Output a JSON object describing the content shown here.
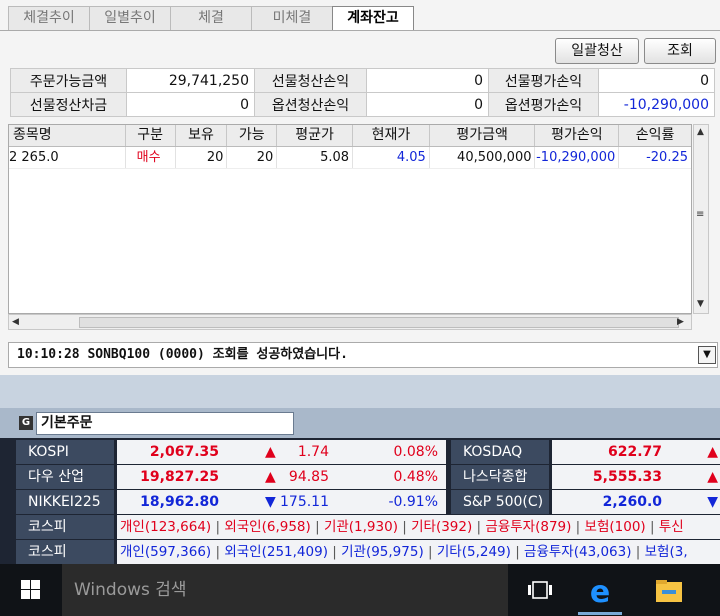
{
  "tabs": [
    {
      "label": "체결추이",
      "active": false
    },
    {
      "label": "일별추이",
      "active": false
    },
    {
      "label": "체결",
      "active": false
    },
    {
      "label": "미체결",
      "active": false
    },
    {
      "label": "계좌잔고",
      "active": true
    }
  ],
  "toolbar": {
    "liquidate_all": "일괄청산",
    "query": "조회"
  },
  "summary": {
    "row1": [
      {
        "label": "주문가능금액",
        "value": "29,741,250"
      },
      {
        "label": "선물청산손익",
        "value": "0"
      },
      {
        "label": "선물평가손익",
        "value": "0"
      }
    ],
    "row2": [
      {
        "label": "선물정산차금",
        "value": "0"
      },
      {
        "label": "옵션청산손익",
        "value": "0"
      },
      {
        "label": "옵션평가손익",
        "value": "-10,290,000"
      }
    ]
  },
  "grid": {
    "headers": [
      "종목명",
      "구분",
      "보유",
      "가능",
      "평균가",
      "현재가",
      "평가금액",
      "평가손익",
      "손익률"
    ],
    "rows": [
      {
        "name": "2 265.0",
        "side": "매수",
        "held": "20",
        "avail": "20",
        "avg": "5.08",
        "cur": "4.05",
        "eval_amt": "40,500,000",
        "eval_pl": "-10,290,000",
        "pl_rate": "-20.25"
      }
    ]
  },
  "status": {
    "message": "10:10:28 SONBQ100 (0000) 조회를 성공하였습니다."
  },
  "order_panel": {
    "icon_letter": "G",
    "title": "기본주문"
  },
  "ticker": {
    "markets": [
      {
        "left_name": "KOSPI",
        "left_value": "2,067.35",
        "left_dir": "up",
        "left_change": "1.74",
        "left_pct": "0.08%",
        "right_name": "KOSDAQ",
        "right_value": "622.77",
        "right_dir": "up"
      },
      {
        "left_name": "다우 산업",
        "left_value": "19,827.25",
        "left_dir": "up",
        "left_change": "94.85",
        "left_pct": "0.48%",
        "right_name": "나스닥종합",
        "right_value": "5,555.33",
        "right_dir": "up"
      },
      {
        "left_name": "NIKKEI225",
        "left_value": "18,962.80",
        "left_dir": "down",
        "left_change": "175.11",
        "left_pct": "-0.91%",
        "right_name": "S&P 500(C)",
        "right_value": "2,260.0",
        "right_dir": "down"
      }
    ],
    "investor_rows": [
      {
        "name": "코스피",
        "color": "#e0001c",
        "items": [
          "개인(123,664)",
          "외국인(6,958)",
          "기관(1,930)",
          "기타(392)",
          "금융투자(879)",
          "보험(100)",
          "투신"
        ]
      },
      {
        "name": "코스피",
        "color": "#1226d8",
        "items": [
          "개인(597,366)",
          "외국인(251,409)",
          "기관(95,975)",
          "기타(5,249)",
          "금융투자(43,063)",
          "보험(3,"
        ]
      }
    ],
    "arrow_up": "▲",
    "arrow_down": "▼"
  },
  "taskbar": {
    "search_placeholder": "Windows 검색"
  }
}
